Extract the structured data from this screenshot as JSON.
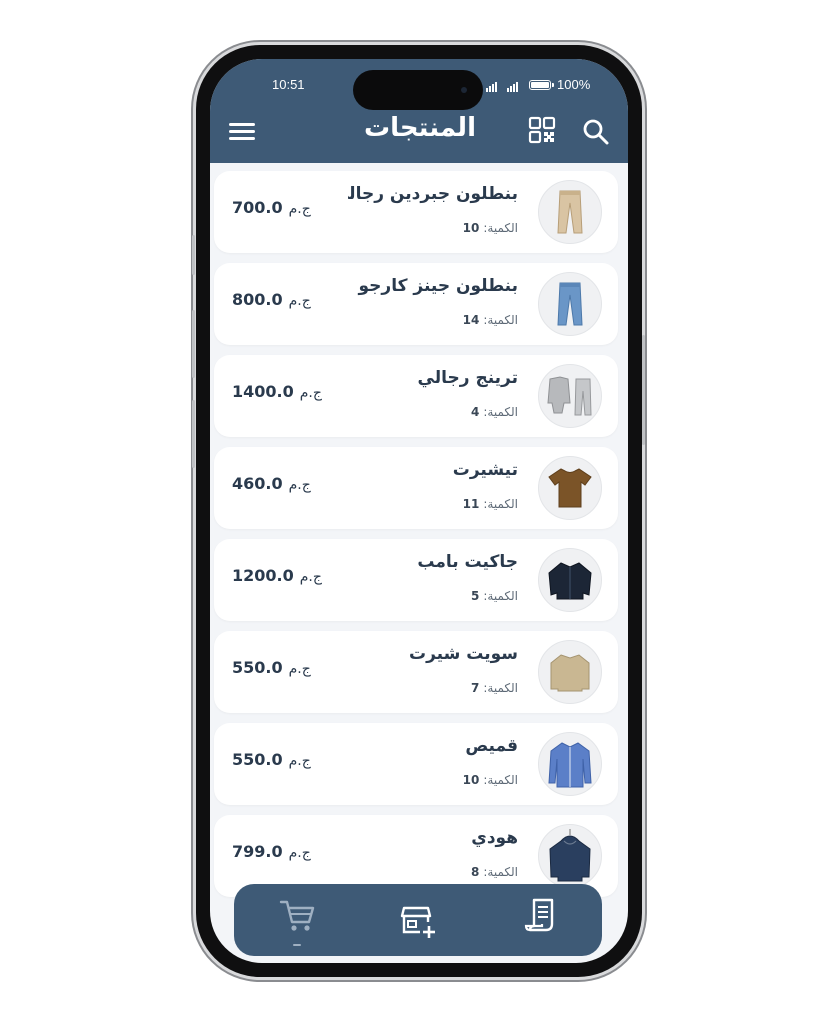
{
  "status_bar": {
    "time": "10:51",
    "battery": "100%"
  },
  "header": {
    "title": "المنتجات"
  },
  "icons": {
    "menu": "menu-icon",
    "qr": "qr-code-icon",
    "search": "search-icon",
    "cart": "cart-icon",
    "add_store": "add-store-icon",
    "receipt": "receipt-icon"
  },
  "colors": {
    "primary": "#3e5a76",
    "background": "#f3f5f8",
    "text": "#2a3a4d"
  },
  "products": [
    {
      "name": "بنطلون جبردين رجالي",
      "quantity_label": "الكمية:",
      "quantity": "10",
      "price": "700.0",
      "currency": "ج.م"
    },
    {
      "name": "بنطلون جينز كارجو",
      "quantity_label": "الكمية:",
      "quantity": "14",
      "price": "800.0",
      "currency": "ج.م"
    },
    {
      "name": "ترينج رجالي",
      "quantity_label": "الكمية:",
      "quantity": "4",
      "price": "1400.0",
      "currency": "ج.م"
    },
    {
      "name": "تيشيرت",
      "quantity_label": "الكمية:",
      "quantity": "11",
      "price": "460.0",
      "currency": "ج.م"
    },
    {
      "name": "جاكيت بامب",
      "quantity_label": "الكمية:",
      "quantity": "5",
      "price": "1200.0",
      "currency": "ج.م"
    },
    {
      "name": "سويت شيرت",
      "quantity_label": "الكمية:",
      "quantity": "7",
      "price": "550.0",
      "currency": "ج.م"
    },
    {
      "name": "قميص",
      "quantity_label": "الكمية:",
      "quantity": "10",
      "price": "550.0",
      "currency": "ج.م"
    },
    {
      "name": "هودي",
      "quantity_label": "الكمية:",
      "quantity": "8",
      "price": "799.0",
      "currency": "ج.م"
    }
  ]
}
